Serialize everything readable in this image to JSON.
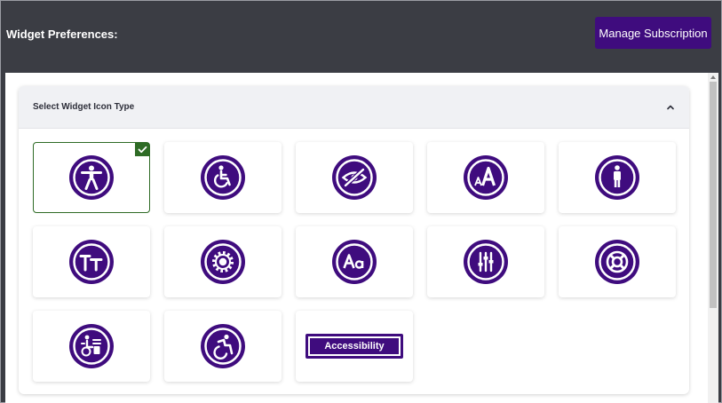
{
  "header": {
    "title": "Widget Preferences:",
    "manage_button": "Manage Subscription"
  },
  "panel": {
    "title": "Select Widget Icon Type",
    "collapse_icon": "chevron-up-icon"
  },
  "colors": {
    "accent": "#3f0c7e",
    "selected": "#2e6b25",
    "header_bg": "#3b3d44"
  },
  "icons": [
    {
      "name": "universal-access-icon",
      "selected": true
    },
    {
      "name": "wheelchair-icon",
      "selected": false
    },
    {
      "name": "eye-slash-icon",
      "selected": false
    },
    {
      "name": "font-size-icon",
      "selected": false
    },
    {
      "name": "person-icon",
      "selected": false
    },
    {
      "name": "text-height-icon",
      "selected": false
    },
    {
      "name": "gear-icon",
      "selected": false
    },
    {
      "name": "text-aa-icon",
      "selected": false
    },
    {
      "name": "sliders-icon",
      "selected": false
    },
    {
      "name": "life-ring-icon",
      "selected": false
    },
    {
      "name": "sign-language-icon",
      "selected": false
    },
    {
      "name": "accessible-wheelchair-icon",
      "selected": false
    },
    {
      "name": "accessibility-button-icon",
      "selected": false,
      "label": "Accessibility"
    }
  ]
}
